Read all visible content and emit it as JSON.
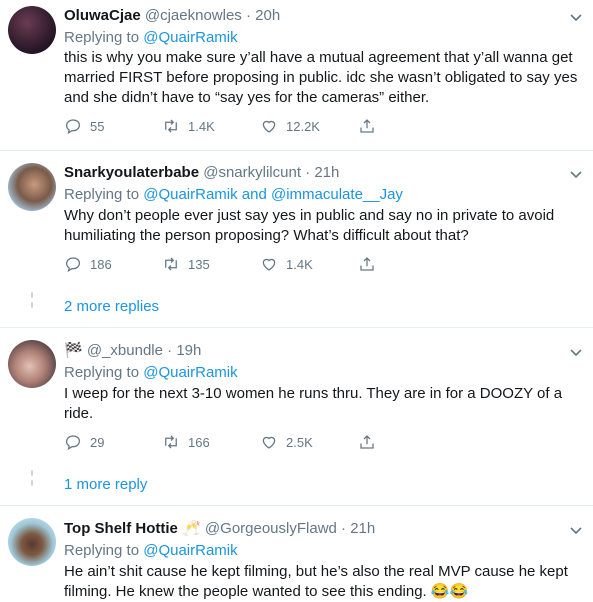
{
  "tweets": [
    {
      "name": "OluwaCjae",
      "handle": "@cjaeknowles",
      "time": "· 20h",
      "replying_label": "Replying to",
      "replying_to": "@QuairRamik",
      "text": "this is why you make sure y’all have a mutual agreement that y’all wanna get married FIRST before proposing in public. idc she wasn’t obligated to say yes and she didn’t have to “say yes for the cameras” either.",
      "replies": "55",
      "retweets": "1.4K",
      "likes": "12.2K"
    },
    {
      "name": "Snarkyoulaterbabe",
      "handle": "@snarkylilcunt",
      "time": "· 21h",
      "replying_label": "Replying to",
      "replying_to": "@QuairRamik and @immaculate__Jay",
      "text": "Why don’t people ever just say yes in public and say no in private to avoid humiliating the person proposing? What’s difficult about that?",
      "replies": "186",
      "retweets": "135",
      "likes": "1.4K",
      "more_replies": "2 more replies"
    },
    {
      "name": "🏁",
      "handle": "@_xbundle",
      "time": "· 19h",
      "replying_label": "Replying to",
      "replying_to": "@QuairRamik",
      "text": "I weep for the next 3-10 women he runs thru. They are in for a DOOZY of a ride.",
      "replies": "29",
      "retweets": "166",
      "likes": "2.5K",
      "more_replies": "1 more reply"
    },
    {
      "name": "Top Shelf Hottie",
      "name_emoji": "🥂",
      "handle": "@GorgeouslyFlawd",
      "time": "· 21h",
      "replying_label": "Replying to",
      "replying_to": "@QuairRamik",
      "text": "He ain’t shit cause he kept filming, but he’s also the real MVP cause he kept filming. He knew the people wanted to see this ending. 😂😂"
    }
  ],
  "icons": {
    "reply": "reply-icon",
    "retweet": "retweet-icon",
    "like": "heart-icon",
    "share": "share-icon",
    "more": "chevron-down-icon"
  },
  "colors": {
    "link": "#1b95e0",
    "secondary": "#657786",
    "divider": "#e6ecf0"
  }
}
